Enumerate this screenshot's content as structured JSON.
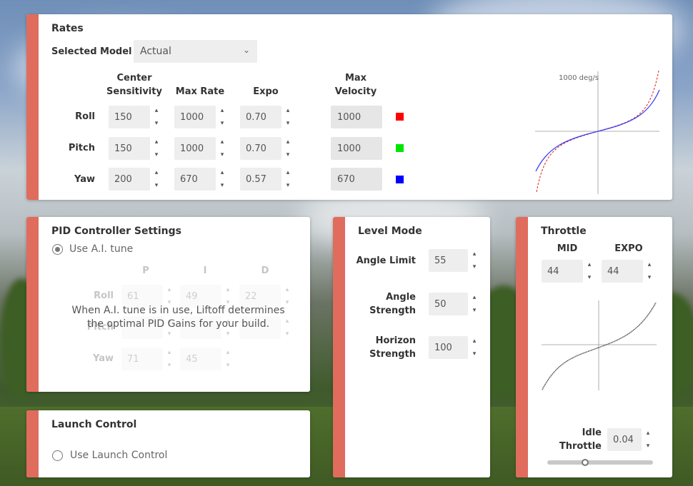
{
  "rates": {
    "title": "Rates",
    "selected_model_label": "Selected Model",
    "selected_model_value": "Actual",
    "columns": {
      "center_sensitivity": [
        "Center",
        "Sensitivity"
      ],
      "max_rate": "Max Rate",
      "expo": "Expo",
      "max_velocity": [
        "Max",
        "Velocity"
      ]
    },
    "rows": [
      {
        "axis": "Roll",
        "center": "150",
        "max_rate": "1000",
        "expo": "0.70",
        "max_velocity": "1000",
        "color": "#ff0000"
      },
      {
        "axis": "Pitch",
        "center": "150",
        "max_rate": "1000",
        "expo": "0.70",
        "max_velocity": "1000",
        "color": "#00e600"
      },
      {
        "axis": "Yaw",
        "center": "200",
        "max_rate": "670",
        "expo": "0.57",
        "max_velocity": "670",
        "color": "#0000ff"
      }
    ],
    "graph_label": "1000 deg/s"
  },
  "pid": {
    "title": "PID Controller Settings",
    "ai_tune_label": "Use A.I. tune",
    "ai_tune_selected": true,
    "headers": [
      "P",
      "I",
      "D"
    ],
    "rows": [
      {
        "axis": "Roll",
        "p": "61",
        "i": "49",
        "d": "22"
      },
      {
        "axis": "Pitch",
        "p": "",
        "i": "",
        "d": ""
      },
      {
        "axis": "Yaw",
        "p": "71",
        "i": "45",
        "d": ""
      }
    ],
    "note_line1": "When A.I. tune is in use, Liftoff determines",
    "note_line2": "the optimal PID Gains for your build."
  },
  "launch": {
    "title": "Launch Control",
    "option_label": "Use Launch Control",
    "selected": false
  },
  "level": {
    "title": "Level Mode",
    "angle_limit_label": "Angle Limit",
    "angle_limit": "55",
    "angle_strength_label": [
      "Angle",
      "Strength"
    ],
    "angle_strength": "50",
    "horizon_strength_label": [
      "Horizon",
      "Strength"
    ],
    "horizon_strength": "100"
  },
  "throttle": {
    "title": "Throttle",
    "mid_label": "MID",
    "mid": "44",
    "expo_label": "EXPO",
    "expo": "44",
    "idle_label": [
      "Idle",
      "Throttle"
    ],
    "idle": "0.04",
    "slider_fraction": 0.35
  },
  "icons": {
    "spin_up": "▴",
    "spin_down": "▾",
    "chevron": "⌄"
  }
}
